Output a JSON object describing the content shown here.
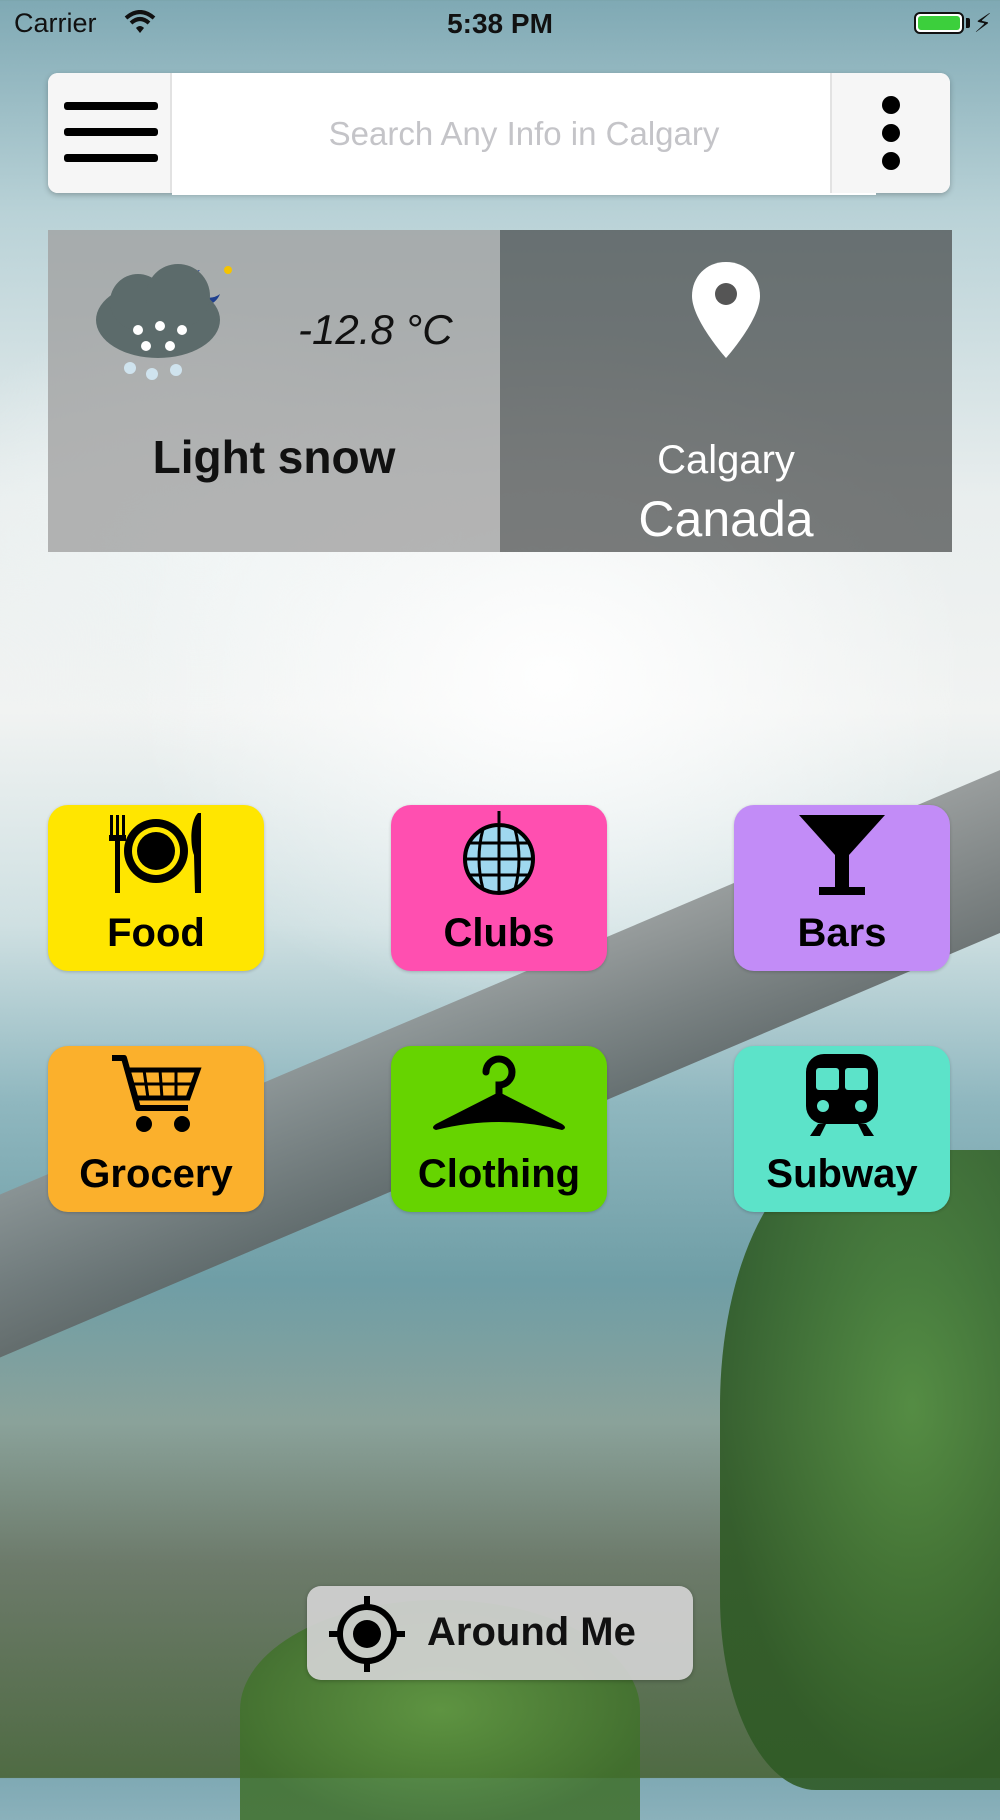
{
  "status_bar": {
    "carrier": "Carrier",
    "time": "5:38 PM",
    "battery_color": "#3ccf3c"
  },
  "search": {
    "placeholder": "Search Any Info in Calgary",
    "menu_icon": "hamburger-menu-icon",
    "more_icon": "vertical-ellipsis-icon"
  },
  "weather": {
    "icon": "snow-cloud-moon-icon",
    "temperature": "-12.8 °C",
    "condition": "Light snow"
  },
  "location": {
    "icon": "map-pin-icon",
    "city": "Calgary",
    "country": "Canada"
  },
  "categories": [
    {
      "label": "Food",
      "icon": "plate-fork-knife-icon",
      "color": "#ffe600"
    },
    {
      "label": "Clubs",
      "icon": "disco-ball-icon",
      "color": "#ff4fb0"
    },
    {
      "label": "Bars",
      "icon": "cocktail-glass-icon",
      "color": "#c28cf7"
    },
    {
      "label": "Grocery",
      "icon": "shopping-cart-icon",
      "color": "#fbb02c"
    },
    {
      "label": "Clothing",
      "icon": "hanger-icon",
      "color": "#66d400"
    },
    {
      "label": "Subway",
      "icon": "train-icon",
      "color": "#5ce3c9"
    }
  ],
  "around_me": {
    "label": "Around Me",
    "icon": "crosshair-target-icon"
  }
}
